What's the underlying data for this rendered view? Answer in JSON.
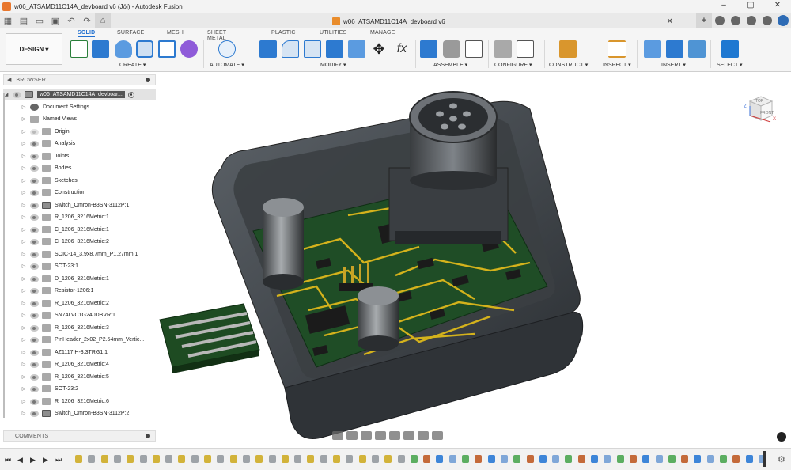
{
  "window": {
    "title": "w06_ATSAMD11C14A_devboard v6 (Jói) - Autodesk Fusion",
    "doc_tab": "w06_ATSAMD11C14A_devboard v6"
  },
  "ribbon": {
    "workspace": "DESIGN ▾",
    "tabs": [
      "SOLID",
      "SURFACE",
      "MESH",
      "SHEET METAL",
      "PLASTIC",
      "UTILITIES",
      "MANAGE"
    ],
    "active_tab": "SOLID",
    "groups": [
      "CREATE ▾",
      "AUTOMATE ▾",
      "MODIFY ▾",
      "ASSEMBLE ▾",
      "CONFIGURE ▾",
      "CONSTRUCT ▾",
      "INSPECT ▾",
      "INSERT ▾",
      "SELECT ▾"
    ],
    "function_symbol": "fx"
  },
  "browser": {
    "title": "BROWSER",
    "root": "w06_ATSAMD11C14A_devboar...",
    "items": [
      "Document Settings",
      "Named Views",
      "Origin",
      "Analysis",
      "Joints",
      "Bodies",
      "Sketches",
      "Construction",
      "Switch_Omron-B3SN-3112P:1",
      "R_1206_3216Metric:1",
      "C_1206_3216Metric:1",
      "C_1206_3216Metric:2",
      "SOIC-14_3.9x8.7mm_P1.27mm:1",
      "SOT-23:1",
      "D_1206_3216Metric:1",
      "Resistor-1206:1",
      "R_1206_3216Metric:2",
      "SN74LVC1G240DBVR:1",
      "R_1206_3216Metric:3",
      "PinHeader_2x02_P2.54mm_Vertic...",
      "AZ1117IH-3.3TRG1:1",
      "R_1206_3216Metric:4",
      "R_1206_3216Metric:5",
      "SOT-23:2",
      "R_1206_3216Metric:6",
      "Switch_Omron-B3SN-3112P:2"
    ]
  },
  "comments": {
    "title": "COMMENTS"
  },
  "viewcube": {
    "top": "TOP",
    "front": "FRONT",
    "axis_x": "X",
    "axis_z": "Z"
  }
}
